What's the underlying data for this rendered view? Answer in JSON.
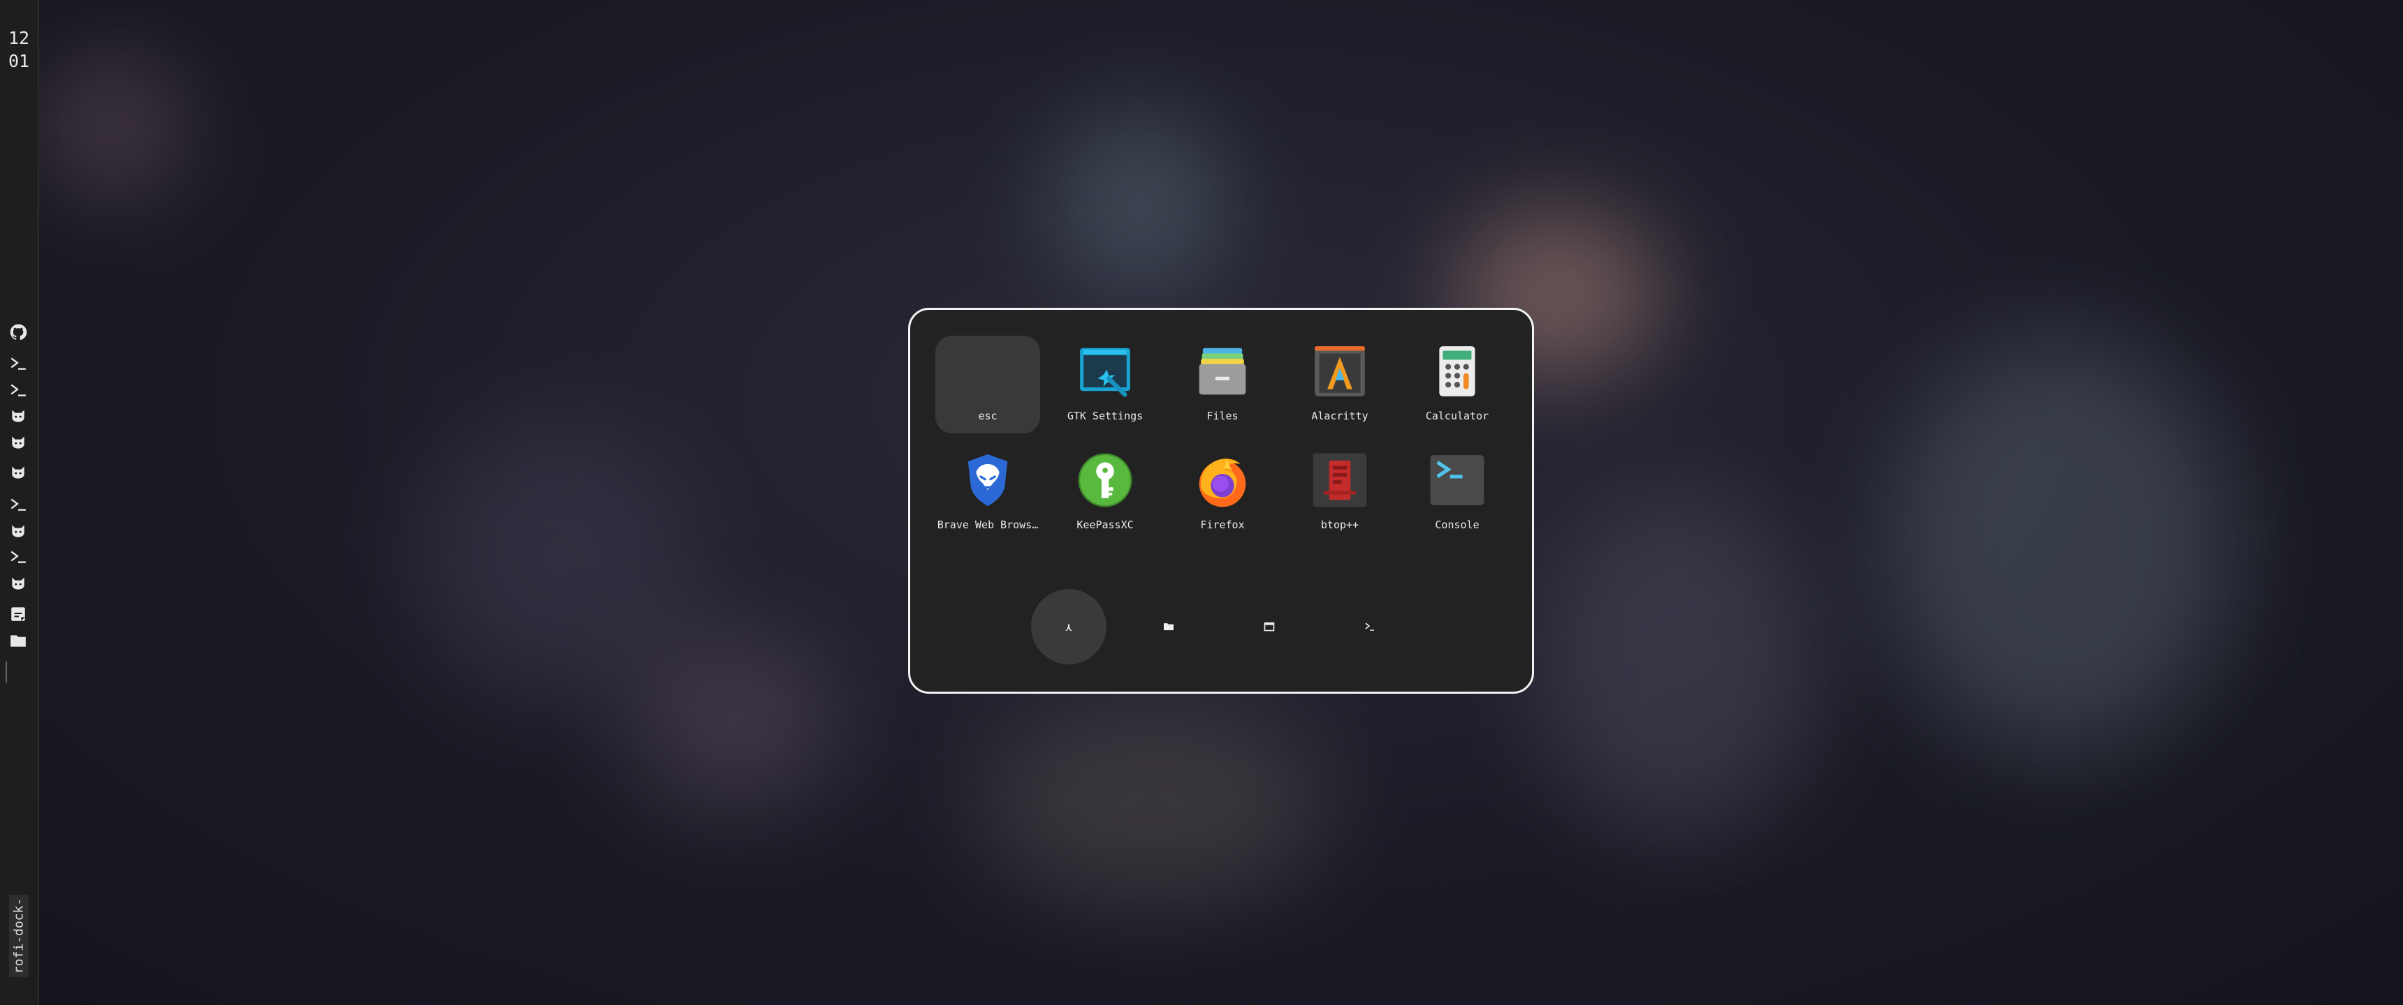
{
  "clock": {
    "hours": "12",
    "minutes": "01"
  },
  "sidebar": {
    "icons": [
      "github-icon",
      "terminal-icon",
      "terminal-icon",
      "cat-icon",
      "cat-icon",
      "cat-icon",
      "terminal-icon",
      "cat-icon",
      "terminal-icon",
      "cat-icon",
      "notes-icon",
      "folder-icon"
    ],
    "workspace_label": "rofi-dock-"
  },
  "launcher": {
    "apps": [
      {
        "label": "esc",
        "icon": "blank",
        "selected": true
      },
      {
        "label": "GTK Settings",
        "icon": "gtk-settings-icon"
      },
      {
        "label": "Files",
        "icon": "files-icon"
      },
      {
        "label": "Alacritty",
        "icon": "alacritty-icon"
      },
      {
        "label": "Calculator",
        "icon": "calculator-icon"
      },
      {
        "label": "Brave Web Brows…",
        "icon": "brave-icon"
      },
      {
        "label": "KeePassXC",
        "icon": "keepassxc-icon"
      },
      {
        "label": "Firefox",
        "icon": "firefox-icon"
      },
      {
        "label": "btop++",
        "icon": "btop-icon"
      },
      {
        "label": "Console",
        "icon": "console-icon"
      }
    ],
    "modes": [
      {
        "name": "apps-mode",
        "glyph": "⋏",
        "active": true
      },
      {
        "name": "files-mode",
        "glyph": "folder-icon"
      },
      {
        "name": "window-mode",
        "glyph": "window-icon"
      },
      {
        "name": "run-mode",
        "glyph": "terminal-icon"
      }
    ]
  },
  "colors": {
    "accent": "#f2f2f2",
    "panel": "#222222",
    "selected": "#393939"
  }
}
